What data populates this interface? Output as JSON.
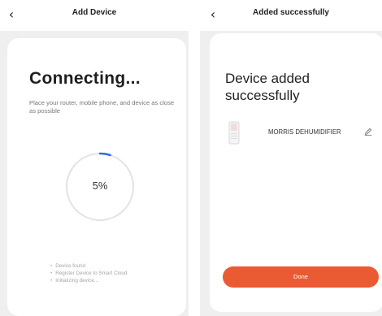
{
  "colors": {
    "accent": "#ea5a33",
    "progress_arc": "#3a6fd8",
    "ring_track": "#e3e3e3",
    "screen_bg": "#efefef",
    "card_bg": "#ffffff"
  },
  "left": {
    "header": {
      "back_icon": "chevron-left-icon",
      "back_glyph": "‹",
      "title": "Add Device"
    },
    "title": "Connecting...",
    "description": "Place your router, mobile phone, and device as close as possible",
    "progress": {
      "value": 5,
      "label": "5%"
    },
    "steps": [
      "Device found",
      "Register Device to Smart Cloud",
      "Initializing device..."
    ]
  },
  "right": {
    "header": {
      "back_icon": "chevron-left-icon",
      "back_glyph": "‹",
      "title": "Added successfully"
    },
    "title": "Device added successfully",
    "device": {
      "icon": "dehumidifier-icon",
      "name": "MORRIS DEHUMIDIFIER",
      "edit_icon": "pencil-icon"
    },
    "done_label": "Done"
  }
}
